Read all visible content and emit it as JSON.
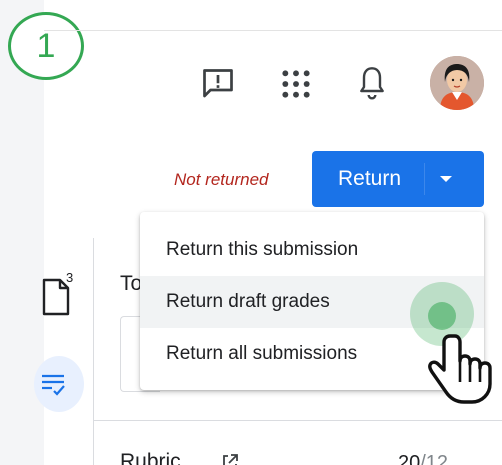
{
  "step_badge": {
    "number": "1"
  },
  "topbar": {
    "icons": [
      "feedback-icon",
      "apps-grid-icon",
      "bell-icon"
    ],
    "avatar": "user-avatar"
  },
  "status": {
    "text": "Not returned",
    "color": "#b3261e"
  },
  "return_button": {
    "label": "Return",
    "color": "#1a73e8",
    "caret_icon": "caret-down-icon"
  },
  "menu": {
    "items": [
      {
        "label": "Return this submission"
      },
      {
        "label": "Return draft grades"
      },
      {
        "label": "Return all submissions"
      }
    ]
  },
  "sidebar": {
    "doc_count": "3",
    "rubric_icon": "rubric-list-icon"
  },
  "panel": {
    "total_label": "To",
    "rubric_label": "Rubric",
    "rubric_score": "20",
    "rubric_max": "/12"
  },
  "accent": {
    "green": "#34a853"
  }
}
